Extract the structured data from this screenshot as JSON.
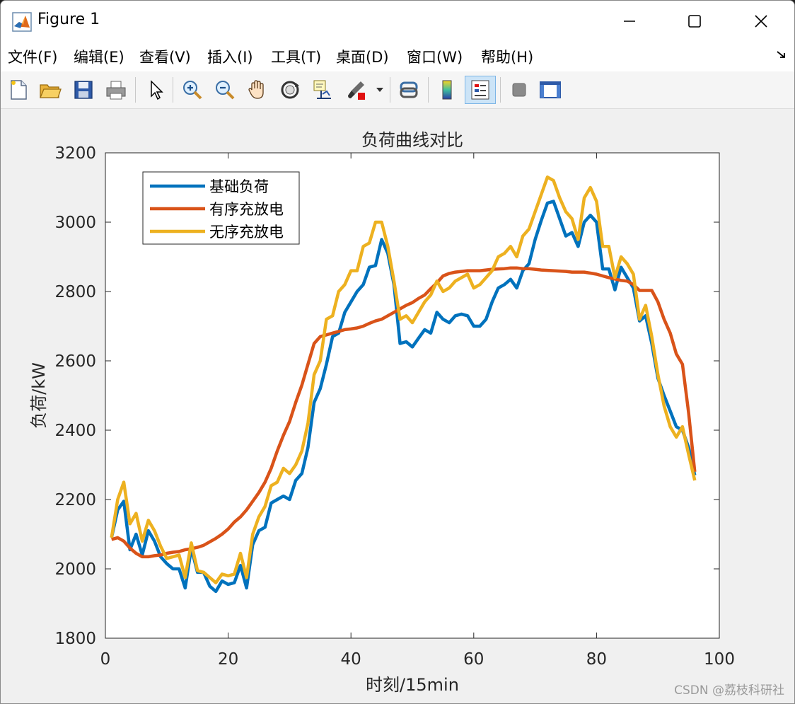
{
  "window": {
    "title": "Figure 1",
    "controls": [
      "minimize",
      "maximize",
      "close"
    ]
  },
  "menubar": {
    "items": [
      "文件(F)",
      "编辑(E)",
      "查看(V)",
      "插入(I)",
      "工具(T)",
      "桌面(D)",
      "窗口(W)",
      "帮助(H)"
    ],
    "overflow_icon": "arrow-corner-icon"
  },
  "toolbar": {
    "buttons": [
      {
        "name": "new-figure",
        "icon": "new-document-icon"
      },
      {
        "name": "open-file",
        "icon": "folder-open-icon"
      },
      {
        "name": "save-figure",
        "icon": "floppy-disk-icon"
      },
      {
        "name": "print-figure",
        "icon": "printer-icon"
      },
      {
        "name": "edit-plot",
        "icon": "pointer-arrow-icon"
      },
      {
        "name": "zoom-in",
        "icon": "zoom-in-icon"
      },
      {
        "name": "zoom-out",
        "icon": "zoom-out-icon"
      },
      {
        "name": "pan",
        "icon": "hand-icon"
      },
      {
        "name": "rotate-3d",
        "icon": "rotate-3d-icon"
      },
      {
        "name": "data-cursor",
        "icon": "data-tip-icon"
      },
      {
        "name": "brush",
        "icon": "brush-icon"
      },
      {
        "name": "link-plot",
        "icon": "link-plot-icon"
      },
      {
        "name": "insert-colorbar",
        "icon": "colorbar-icon"
      },
      {
        "name": "insert-legend",
        "icon": "legend-icon",
        "active": true
      },
      {
        "name": "hide-plot-tools",
        "icon": "gray-square-icon"
      },
      {
        "name": "show-plot-tools",
        "icon": "plot-tools-icon"
      }
    ]
  },
  "watermark": "CSDN @荔枝科研社",
  "colors": {
    "series1": "#0072BD",
    "series2": "#D95319",
    "series3": "#EDB120"
  },
  "chart_data": {
    "type": "line",
    "title": "负荷曲线对比",
    "xlabel": "时刻/15min",
    "ylabel": "负荷/kW",
    "xlim": [
      0,
      100
    ],
    "ylim": [
      1800,
      3200
    ],
    "xticks": [
      0,
      20,
      40,
      60,
      80,
      100
    ],
    "yticks": [
      1800,
      2000,
      2200,
      2400,
      2600,
      2800,
      3000,
      3200
    ],
    "grid": false,
    "legend_position": "top-left",
    "x": [
      1,
      2,
      3,
      4,
      5,
      6,
      7,
      8,
      9,
      10,
      11,
      12,
      13,
      14,
      15,
      16,
      17,
      18,
      19,
      20,
      21,
      22,
      23,
      24,
      25,
      26,
      27,
      28,
      29,
      30,
      31,
      32,
      33,
      34,
      35,
      36,
      37,
      38,
      39,
      40,
      41,
      42,
      43,
      44,
      45,
      46,
      47,
      48,
      49,
      50,
      51,
      52,
      53,
      54,
      55,
      56,
      57,
      58,
      59,
      60,
      61,
      62,
      63,
      64,
      65,
      66,
      67,
      68,
      69,
      70,
      71,
      72,
      73,
      74,
      75,
      76,
      77,
      78,
      79,
      80,
      81,
      82,
      83,
      84,
      85,
      86,
      87,
      88,
      89,
      90,
      91,
      92,
      93,
      94,
      95,
      96
    ],
    "series": [
      {
        "name": "基础负荷",
        "values": [
          2090,
          2170,
          2195,
          2055,
          2100,
          2040,
          2110,
          2080,
          2035,
          2015,
          2000,
          2000,
          1945,
          2060,
          1990,
          1990,
          1950,
          1935,
          1965,
          1955,
          1960,
          2010,
          1945,
          2070,
          2110,
          2120,
          2190,
          2200,
          2210,
          2200,
          2255,
          2275,
          2350,
          2480,
          2520,
          2590,
          2670,
          2680,
          2740,
          2770,
          2800,
          2820,
          2870,
          2875,
          2950,
          2910,
          2820,
          2650,
          2655,
          2640,
          2665,
          2690,
          2680,
          2740,
          2720,
          2710,
          2730,
          2735,
          2730,
          2700,
          2700,
          2720,
          2770,
          2810,
          2820,
          2835,
          2810,
          2860,
          2880,
          2950,
          3005,
          3055,
          3060,
          3010,
          2960,
          2970,
          2930,
          3000,
          3020,
          3000,
          2865,
          2865,
          2805,
          2870,
          2840,
          2810,
          2715,
          2730,
          2650,
          2550,
          2500,
          2455,
          2410,
          2400,
          2350,
          2270
        ]
      },
      {
        "name": "有序充放电",
        "values": [
          2085,
          2090,
          2080,
          2060,
          2045,
          2035,
          2035,
          2038,
          2040,
          2045,
          2048,
          2050,
          2055,
          2058,
          2062,
          2068,
          2078,
          2088,
          2100,
          2115,
          2135,
          2150,
          2170,
          2195,
          2220,
          2250,
          2290,
          2340,
          2385,
          2425,
          2480,
          2530,
          2590,
          2650,
          2670,
          2675,
          2680,
          2685,
          2690,
          2692,
          2695,
          2700,
          2708,
          2715,
          2720,
          2730,
          2740,
          2750,
          2760,
          2768,
          2780,
          2790,
          2808,
          2825,
          2845,
          2852,
          2856,
          2858,
          2860,
          2860,
          2860,
          2862,
          2864,
          2865,
          2866,
          2868,
          2868,
          2866,
          2866,
          2864,
          2862,
          2861,
          2860,
          2859,
          2858,
          2856,
          2856,
          2856,
          2853,
          2850,
          2845,
          2840,
          2836,
          2832,
          2830,
          2820,
          2803,
          2803,
          2803,
          2770,
          2720,
          2680,
          2620,
          2590,
          2450,
          2280
        ]
      },
      {
        "name": "无序充放电",
        "values": [
          2090,
          2200,
          2250,
          2130,
          2160,
          2080,
          2140,
          2110,
          2065,
          2030,
          2035,
          2040,
          1975,
          2075,
          1995,
          1990,
          1975,
          1960,
          1985,
          1980,
          1985,
          2045,
          1975,
          2100,
          2150,
          2180,
          2240,
          2250,
          2290,
          2275,
          2300,
          2340,
          2420,
          2560,
          2600,
          2720,
          2730,
          2800,
          2820,
          2860,
          2860,
          2930,
          2940,
          3000,
          3000,
          2930,
          2830,
          2720,
          2730,
          2710,
          2740,
          2770,
          2790,
          2830,
          2800,
          2810,
          2830,
          2840,
          2850,
          2810,
          2820,
          2840,
          2860,
          2900,
          2910,
          2930,
          2900,
          2960,
          2980,
          3030,
          3080,
          3130,
          3120,
          3070,
          3030,
          3010,
          2950,
          3070,
          3100,
          3060,
          2930,
          2930,
          2840,
          2900,
          2880,
          2850,
          2720,
          2760,
          2670,
          2560,
          2470,
          2410,
          2380,
          2410,
          2330,
          2255
        ]
      }
    ]
  }
}
